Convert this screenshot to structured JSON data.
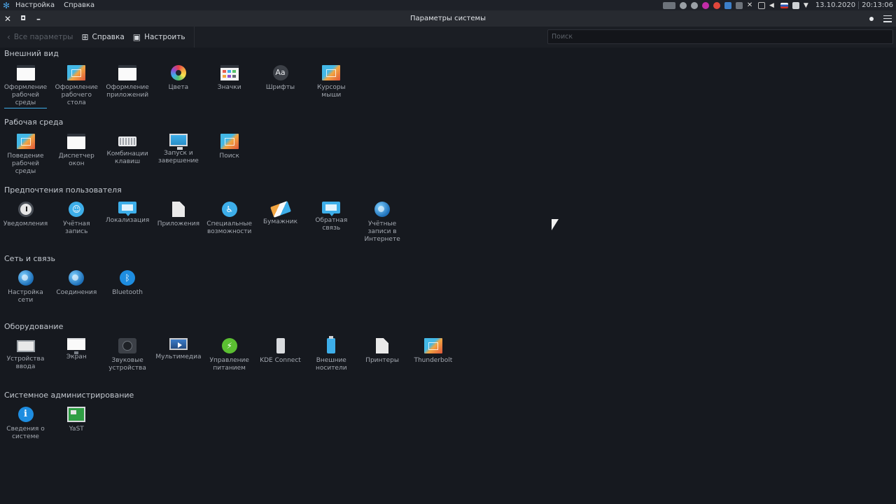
{
  "top_panel": {
    "menus": [
      "Настройка",
      "Справка"
    ],
    "date": "13.10.2020",
    "time": "20:13:06",
    "colors": {
      "panel_bg": "#1e2128"
    }
  },
  "window": {
    "title": "Параметры системы",
    "close_glyph": "✕",
    "max_glyph": "▫",
    "min_glyph": "–"
  },
  "toolbar": {
    "back_label": "Все параметры",
    "help_label": "Справка",
    "configure_label": "Настроить",
    "search_placeholder": "Поиск"
  },
  "sections": [
    {
      "title": "Внешний вид",
      "items": [
        {
          "label": "Оформление рабочей среды",
          "icon": "window-icon"
        },
        {
          "label": "Оформление рабочего стола",
          "icon": "wallpaper-icon"
        },
        {
          "label": "Оформление приложений",
          "icon": "window-icon"
        },
        {
          "label": "Цвета",
          "icon": "color-wheel-icon"
        },
        {
          "label": "Значки",
          "icon": "icons-grid-icon"
        },
        {
          "label": "Шрифты",
          "icon": "font-icon"
        },
        {
          "label": "Курсоры мыши",
          "icon": "wallpaper-icon"
        }
      ]
    },
    {
      "title": "Рабочая среда",
      "items": [
        {
          "label": "Поведение рабочей среды",
          "icon": "wallpaper-icon"
        },
        {
          "label": "Диспетчер окон",
          "icon": "window-icon"
        },
        {
          "label": "Комбинации клавиш",
          "icon": "keyboard-icon"
        },
        {
          "label": "Запуск и завершение",
          "icon": "monitor-icon"
        },
        {
          "label": "Поиск",
          "icon": "wallpaper-icon"
        }
      ]
    },
    {
      "title": "Предпочтения пользователя",
      "items": [
        {
          "label": "Уведомления",
          "icon": "notification-icon"
        },
        {
          "label": "Учётная запись",
          "icon": "user-icon"
        },
        {
          "label": "Локализация",
          "icon": "chat-bubble-icon"
        },
        {
          "label": "Приложения",
          "icon": "document-icon"
        },
        {
          "label": "Специальные возможности",
          "icon": "accessibility-icon"
        },
        {
          "label": "Бумажник",
          "icon": "wallet-icon"
        },
        {
          "label": "Обратная связь",
          "icon": "chat-bubble-icon"
        },
        {
          "label": "Учётные записи в Интернете",
          "icon": "globe-icon"
        }
      ]
    },
    {
      "title": "Сеть и связь",
      "items": [
        {
          "label": "Настройка сети",
          "icon": "globe-icon"
        },
        {
          "label": "Соединения",
          "icon": "globe-icon"
        },
        {
          "label": "Bluetooth",
          "icon": "bluetooth-icon"
        }
      ]
    },
    {
      "title": "Оборудование",
      "items": [
        {
          "label": "Устройства ввода",
          "icon": "tablet-icon"
        },
        {
          "label": "Экран",
          "icon": "display-icon"
        },
        {
          "label": "Звуковые устройства",
          "icon": "speaker-icon"
        },
        {
          "label": "Мультимедиа",
          "icon": "multimedia-icon"
        },
        {
          "label": "Управление питанием",
          "icon": "power-icon"
        },
        {
          "label": "KDE Connect",
          "icon": "phone-icon"
        },
        {
          "label": "Внешние носители",
          "icon": "usb-icon"
        },
        {
          "label": "Принтеры",
          "icon": "document-icon"
        },
        {
          "label": "Thunderbolt",
          "icon": "wallpaper-icon"
        }
      ]
    },
    {
      "title": "Системное администрирование",
      "items": [
        {
          "label": "Сведения о системе",
          "icon": "info-icon"
        },
        {
          "label": "YaST",
          "icon": "yast-icon"
        }
      ]
    }
  ],
  "selected_item": "Оформление рабочей среды",
  "colors": {
    "background": "#16191f",
    "accent": "#3daee9",
    "text": "#a3a8b0"
  }
}
